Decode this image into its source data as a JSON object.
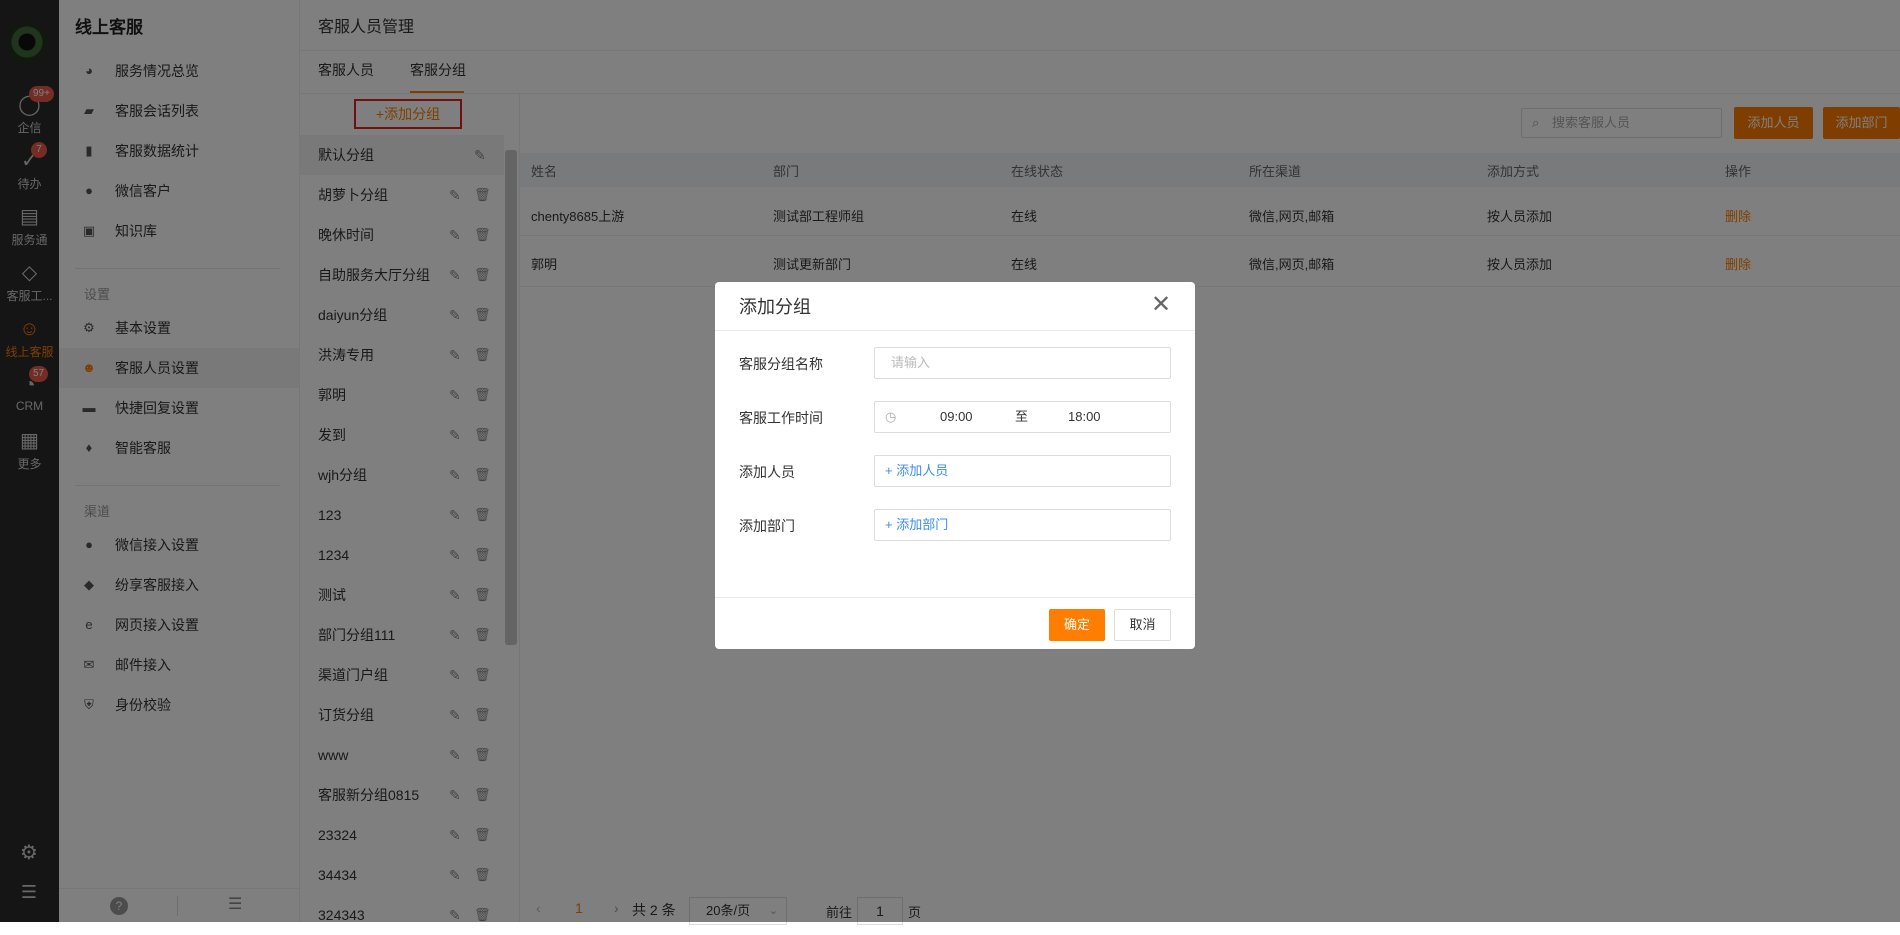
{
  "rail": {
    "items": [
      {
        "label": "企信",
        "icon": "chat-bubble-icon",
        "glyph": "◯",
        "badge": "99+"
      },
      {
        "label": "待办",
        "icon": "check-circle-icon",
        "glyph": "✓",
        "badge": "7"
      },
      {
        "label": "服务通",
        "icon": "clipboard-icon",
        "glyph": "▤",
        "badge": ""
      },
      {
        "label": "客服工...",
        "icon": "cube-icon",
        "glyph": "◇",
        "badge": ""
      },
      {
        "label": "线上客服",
        "icon": "headset-icon",
        "glyph": "☺",
        "badge": ""
      },
      {
        "label": "CRM",
        "icon": "clock-icon",
        "glyph": "◔",
        "badge": "57"
      },
      {
        "label": "更多",
        "icon": "grid-icon",
        "glyph": "▦",
        "badge": ""
      }
    ],
    "settings_glyph": "⚙",
    "user_glyph": "☰"
  },
  "sidebar": {
    "title": "线上客服",
    "main_items": [
      {
        "label": "服务情况总览",
        "glyph": "◕"
      },
      {
        "label": "客服会话列表",
        "glyph": "▰"
      },
      {
        "label": "客服数据统计",
        "glyph": "▮"
      },
      {
        "label": "微信客户",
        "glyph": "●"
      },
      {
        "label": "知识库",
        "glyph": "▣"
      }
    ],
    "settings_label": "设置",
    "settings_items": [
      {
        "label": "基本设置",
        "glyph": "⚙"
      },
      {
        "label": "客服人员设置",
        "glyph": "☻"
      },
      {
        "label": "快捷回复设置",
        "glyph": "▬"
      },
      {
        "label": "智能客服",
        "glyph": "♦"
      }
    ],
    "channels_label": "渠道",
    "channel_items": [
      {
        "label": "微信接入设置",
        "glyph": "●"
      },
      {
        "label": "纷享客服接入",
        "glyph": "◆"
      },
      {
        "label": "网页接入设置",
        "glyph": "e"
      },
      {
        "label": "邮件接入",
        "glyph": "✉"
      },
      {
        "label": "身份校验",
        "glyph": "⛨"
      }
    ],
    "footer_help_glyph": "?",
    "footer_collapse_glyph": "☰"
  },
  "header": {
    "title": "客服人员管理",
    "tabs": [
      "客服人员",
      "客服分组"
    ]
  },
  "groups": {
    "add_label": "+添加分组",
    "items": [
      "默认分组",
      "胡萝卜分组",
      "晚休时间",
      "自助服务大厅分组",
      "daiyun分组",
      "洪涛专用",
      "郭明",
      "发到",
      "wjh分组",
      "123",
      "1234",
      "测试",
      "部门分组111",
      "渠道门户组",
      "订货分组",
      "www",
      "客服新分组0815",
      "23324",
      "34434",
      "324343"
    ],
    "edit_glyph": "✎",
    "delete_glyph": "🗑"
  },
  "toolbar": {
    "search_placeholder": "搜索客服人员",
    "add_member": "添加人员",
    "add_dept": "添加部门"
  },
  "table": {
    "columns": [
      "姓名",
      "部门",
      "在线状态",
      "所在渠道",
      "添加方式",
      "操作"
    ],
    "rows": [
      [
        "chenty8685上游",
        "测试部工程师组",
        "在线",
        "微信,网页,邮箱",
        "按人员添加",
        "删除"
      ],
      [
        "郭明",
        "测试更新部门",
        "在线",
        "微信,网页,邮箱",
        "按人员添加",
        "删除"
      ]
    ]
  },
  "pagination": {
    "prev": "‹",
    "current": "1",
    "next": "›",
    "total": "共 2 条",
    "page_size": "20条/页",
    "goto_label": "前往",
    "goto_value": "1",
    "page_unit": "页"
  },
  "modal": {
    "title": "添加分组",
    "close": "✕",
    "fields": {
      "name_label": "客服分组名称",
      "name_placeholder": "请输入",
      "time_label": "客服工作时间",
      "time_start": "09:00",
      "time_sep": "至",
      "time_end": "18:00",
      "member_label": "添加人员",
      "member_link": "+ 添加人员",
      "dept_label": "添加部门",
      "dept_link": "+ 添加部门"
    },
    "ok": "确定",
    "cancel": "取消"
  },
  "colors": {
    "accent": "#ff7d00",
    "badge": "#e85b4b",
    "link": "#3c8cf0"
  }
}
